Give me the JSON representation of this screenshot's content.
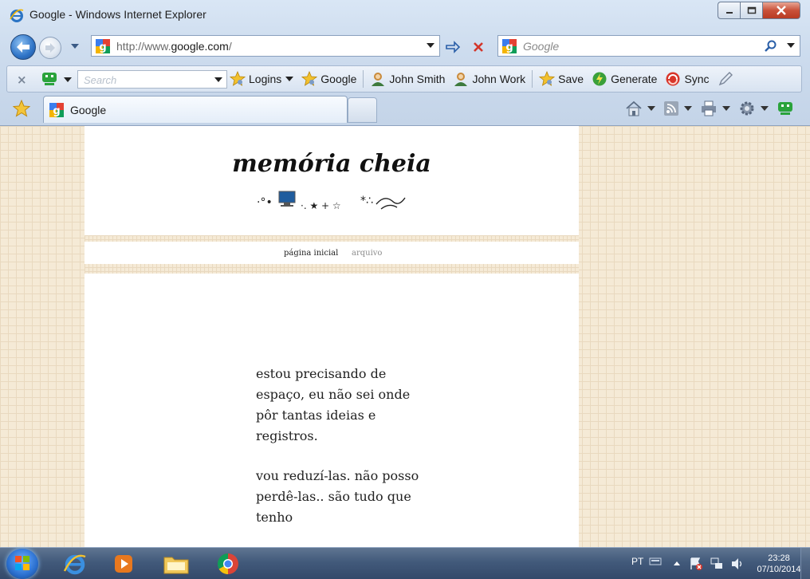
{
  "window": {
    "title": "Google - Windows Internet Explorer"
  },
  "address_bar": {
    "url_prefix": "http://www.",
    "url_domain": "google.com",
    "url_suffix": "/"
  },
  "search_bar": {
    "placeholder": "Google"
  },
  "toolbar": {
    "search_placeholder": "Search",
    "items": [
      {
        "label": "Logins",
        "icon": "star-key-icon"
      },
      {
        "label": "Google",
        "icon": "star-key-icon"
      },
      {
        "label": "John Smith",
        "icon": "identity-icon"
      },
      {
        "label": "John Work",
        "icon": "identity-icon"
      },
      {
        "label": "Save",
        "icon": "star-key-icon"
      },
      {
        "label": "Generate",
        "icon": "generate-icon"
      },
      {
        "label": "Sync",
        "icon": "sync-icon"
      }
    ]
  },
  "tabs": [
    {
      "label": "Google"
    }
  ],
  "blog": {
    "title": "memória cheia",
    "decoration": "·°• 🖥️ ·. ★ + ☆ *∴༄",
    "nav": {
      "home": "página inicial",
      "archive": "arquivo"
    },
    "post": {
      "paragraph_1": "estou precisando de espaço, eu não sei onde pôr tantas ideias e registros.",
      "paragraph_2": "vou reduzí-las. não posso perdê-las.. são tudo que tenho"
    }
  },
  "taskbar": {
    "language": "PT",
    "time": "23:28",
    "date": "07/10/2014"
  },
  "colors": {
    "page_background": "#f5ead6",
    "grid_line": "#e9d9bf",
    "close_button": "#c9513a",
    "taskbar": "#425a7b"
  }
}
